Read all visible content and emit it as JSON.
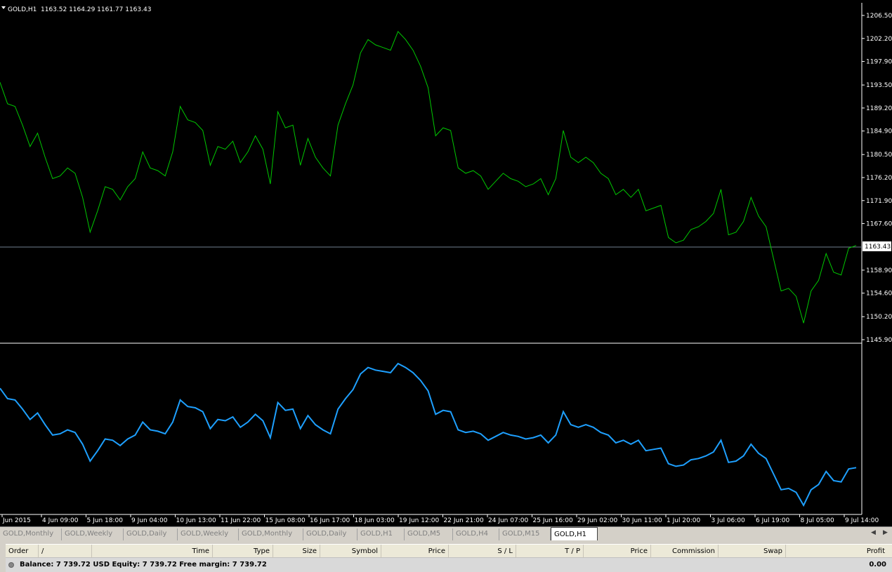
{
  "chart_header": {
    "symbol": "GOLD,H1",
    "ohlc": "1163.52 1164.29 1161.77 1163.43"
  },
  "current_price": "1163.43",
  "chart_data": {
    "type": "line",
    "series": [
      {
        "color": "#00c800",
        "values": [
          1194.0,
          1190.0,
          1189.5,
          1186.0,
          1182.0,
          1184.5,
          1180.0,
          1176.0,
          1176.5,
          1178.0,
          1177.0,
          1172.5,
          1166.0,
          1170.0,
          1174.5,
          1174.0,
          1172.0,
          1174.5,
          1176.0,
          1181.0,
          1178.0,
          1177.5,
          1176.5,
          1181.0,
          1189.5,
          1187.0,
          1186.5,
          1185.0,
          1178.5,
          1182.0,
          1181.5,
          1183.0,
          1179.0,
          1181.0,
          1184.0,
          1181.5,
          1175.0,
          1188.5,
          1185.5,
          1186.0,
          1178.5,
          1183.5,
          1180.0,
          1178.0,
          1176.5,
          1186.0,
          1190.0,
          1193.5,
          1199.5,
          1202.0,
          1201.0,
          1200.5,
          1200.0,
          1203.5,
          1202.0,
          1200.0,
          1197.0,
          1193.0,
          1184.0,
          1185.5,
          1185.0,
          1178.0,
          1177.0,
          1177.5,
          1176.5,
          1174.0,
          1175.5,
          1177.0,
          1176.0,
          1175.5,
          1174.5,
          1175.0,
          1176.0,
          1173.0,
          1176.0,
          1185.0,
          1180.0,
          1179.0,
          1180.0,
          1179.0,
          1177.0,
          1176.0,
          1173.0,
          1174.0,
          1172.5,
          1174.0,
          1170.0,
          1170.5,
          1171.0,
          1165.0,
          1164.0,
          1164.5,
          1166.5,
          1167.0,
          1168.0,
          1169.5,
          1174.0,
          1165.5,
          1166.0,
          1168.0,
          1172.5,
          1169.0,
          1167.0,
          1161.0,
          1155.0,
          1155.5,
          1154.0,
          1149.0,
          1155.0,
          1157.0,
          1162.0,
          1158.5,
          1158.0,
          1163.0,
          1163.5
        ]
      },
      {
        "color": "#1ea0ff",
        "values": [
          1194.0,
          1190.0,
          1189.5,
          1186.0,
          1182.0,
          1184.5,
          1180.0,
          1176.0,
          1176.5,
          1178.0,
          1177.0,
          1172.5,
          1166.0,
          1170.0,
          1174.5,
          1174.0,
          1172.0,
          1174.5,
          1176.0,
          1181.0,
          1178.0,
          1177.5,
          1176.5,
          1181.0,
          1189.5,
          1187.0,
          1186.5,
          1185.0,
          1178.5,
          1182.0,
          1181.5,
          1183.0,
          1179.0,
          1181.0,
          1184.0,
          1181.5,
          1175.0,
          1188.5,
          1185.5,
          1186.0,
          1178.5,
          1183.5,
          1180.0,
          1178.0,
          1176.5,
          1186.0,
          1190.0,
          1193.5,
          1199.5,
          1202.0,
          1201.0,
          1200.5,
          1200.0,
          1203.5,
          1202.0,
          1200.0,
          1197.0,
          1193.0,
          1184.0,
          1185.5,
          1185.0,
          1178.0,
          1177.0,
          1177.5,
          1176.5,
          1174.0,
          1175.5,
          1177.0,
          1176.0,
          1175.5,
          1174.5,
          1175.0,
          1176.0,
          1173.0,
          1176.0,
          1185.0,
          1180.0,
          1179.0,
          1180.0,
          1179.0,
          1177.0,
          1176.0,
          1173.0,
          1174.0,
          1172.5,
          1174.0,
          1170.0,
          1170.5,
          1171.0,
          1165.0,
          1164.0,
          1164.5,
          1166.5,
          1167.0,
          1168.0,
          1169.5,
          1174.0,
          1165.5,
          1166.0,
          1168.0,
          1172.5,
          1169.0,
          1167.0,
          1161.0,
          1155.0,
          1155.5,
          1154.0,
          1149.0,
          1155.0,
          1157.0,
          1162.0,
          1158.5,
          1158.0,
          1163.0,
          1163.5
        ]
      }
    ],
    "ylim": [
      1144.8,
      1207.2
    ],
    "y_ticks": [
      "1206.50",
      "1202.20",
      "1197.90",
      "1193.50",
      "1189.20",
      "1184.90",
      "1180.50",
      "1176.20",
      "1171.90",
      "1167.60",
      "1163.43",
      "1158.90",
      "1154.60",
      "1150.20",
      "1145.90"
    ],
    "x_ticks": [
      "Jun 2015",
      "4 Jun 09:00",
      "5 Jun 18:00",
      "9 Jun 04:00",
      "10 Jun 13:00",
      "11 Jun 22:00",
      "15 Jun 08:00",
      "16 Jun 17:00",
      "18 Jun 03:00",
      "19 Jun 12:00",
      "22 Jun 21:00",
      "24 Jun 07:00",
      "25 Jun 16:00",
      "29 Jun 02:00",
      "30 Jun 11:00",
      "1 Jul 20:00",
      "3 Jul 06:00",
      "6 Jul 19:00",
      "8 Jul 05:00",
      "9 Jul 14:00"
    ],
    "grid": false
  },
  "tabs": [
    "GOLD,Monthly",
    "GOLD,Weekly",
    "GOLD,Daily",
    "GOLD,Weekly",
    "GOLD,Monthly",
    "GOLD,Daily",
    "GOLD,H1",
    "GOLD,M5",
    "GOLD,H4",
    "GOLD,M15",
    "GOLD,H1"
  ],
  "active_tab": 10,
  "tab_arrows": {
    "left": "◀",
    "right": "▶"
  },
  "terminal": {
    "columns": [
      "Order",
      "/",
      "Time",
      "Type",
      "Size",
      "Symbol",
      "Price",
      "S / L",
      "T / P",
      "Price",
      "Commission",
      "Swap",
      "Profit"
    ],
    "summary": "Balance: 7 739.72 USD  Equity: 7 739.72  Free margin: 7 739.72",
    "profit": "0.00"
  },
  "colors": {
    "main_line": "#00c800",
    "indicator_line": "#1ea0ff",
    "background": "#000000",
    "axis": "#ffffff",
    "price_line": "#708090"
  }
}
